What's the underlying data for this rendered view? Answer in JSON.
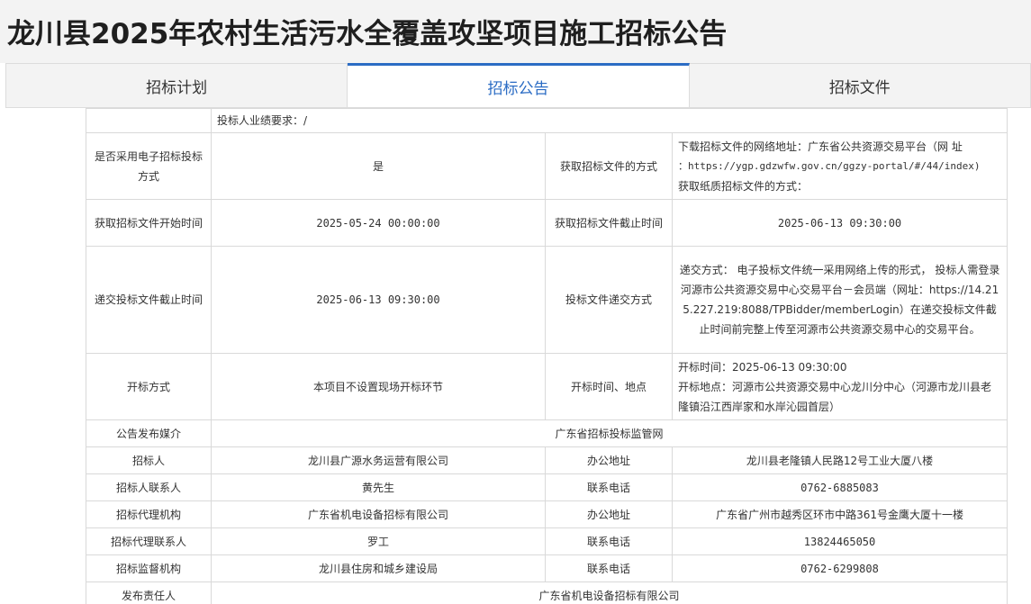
{
  "title": "龙川县2025年农村生活污水全覆盖攻坚项目施工招标公告",
  "tabs": [
    {
      "label": "招标计划"
    },
    {
      "label": "招标公告"
    },
    {
      "label": "招标文件"
    }
  ],
  "table": {
    "perf_req": "投标人业绩要求：/",
    "electronic_label": "是否采用电子招标投标方式",
    "electronic_value": "是",
    "obtain_label": "获取招标文件的方式",
    "obtain_line1": "下载招标文件的网络地址：广东省公共资源交易平台（网 址",
    "obtain_line2": "：https://ygp.gdzwfw.gov.cn/ggzy-portal/#/44/index)",
    "obtain_line3": "获取纸质招标文件的方式：",
    "start_label": "获取招标文件开始时间",
    "start_value": "2025-05-24 00:00:00",
    "end_label": "获取招标文件截止时间",
    "end_value": "2025-06-13 09:30:00",
    "submit_deadline_label": "递交投标文件截止时间",
    "submit_deadline_value": "2025-06-13 09:30:00",
    "submit_method_label": "投标文件递交方式",
    "submit_method_value": "递交方式： 电子投标文件统一采用网络上传的形式， 投标人需登录河源市公共资源交易中心交易平台－会员端（网址：https://14.215.227.219:8088/TPBidder/memberLogin）在递交投标文件截止时间前完整上传至河源市公共资源交易中心的交易平台。",
    "open_method_label": "开标方式",
    "open_method_value": "本项目不设置现场开标环节",
    "open_time_label": "开标时间、地点",
    "open_time_line1": "开标时间：2025-06-13 09:30:00",
    "open_time_line2": "开标地点：河源市公共资源交易中心龙川分中心（河源市龙川县老隆镇沿江西岸家和水岸沁园首层）",
    "media_label": "公告发布媒介",
    "media_value": "广东省招标投标监管网",
    "tenderer_label": "招标人",
    "tenderer_value": "龙川县广源水务运营有限公司",
    "office_label": "办公地址",
    "tenderer_office": "龙川县老隆镇人民路12号工业大厦八楼",
    "tenderer_contact_label": "招标人联系人",
    "tenderer_contact": "黄先生",
    "phone_label": "联系电话",
    "tenderer_phone": "0762-6885083",
    "agency_label": "招标代理机构",
    "agency_value": "广东省机电设备招标有限公司",
    "agency_office": "广东省广州市越秀区环市中路361号金鹰大厦十一楼",
    "agency_contact_label": "招标代理联系人",
    "agency_contact": "罗工",
    "agency_phone": "13824465050",
    "supervisor_label": "招标监督机构",
    "supervisor_value": "龙川县住房和城乡建设局",
    "supervisor_phone": "0762-6299808",
    "publisher_label": "发布责任人",
    "publisher_value": "广东省机电设备招标有限公司"
  }
}
